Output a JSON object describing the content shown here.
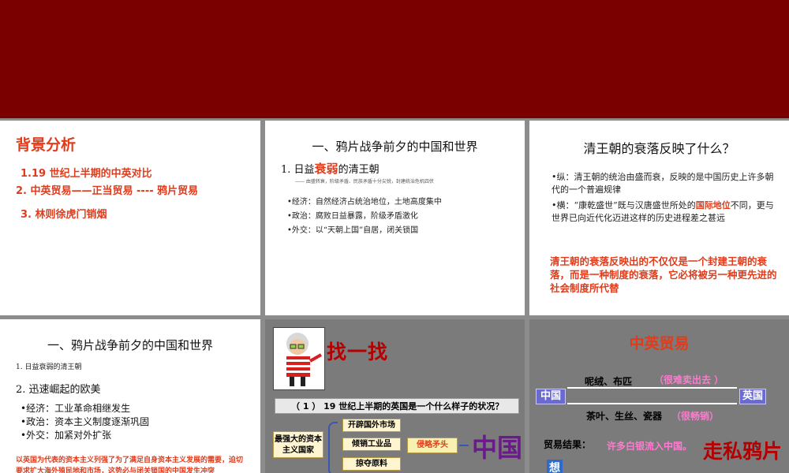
{
  "slide1": {
    "title": "背景分析",
    "items": [
      "1.19 世纪上半期的中英对比",
      "2. 中英贸易——正当贸易 ---- 鸦片贸易",
      "3. 林则徐虎门销烟"
    ]
  },
  "slide2": {
    "heading": "一、鸦片战争前夕的中国和世界",
    "sub_prefix": "1. 日益",
    "sub_emph": "衰弱",
    "sub_suffix": "的清王朝",
    "quote": "—— 由盛转衰，阶级矛盾、民族矛盾十分尖锐，封建统治危机四伏",
    "bullets": [
      "•经济：自然经济占统治地位，土地高度集中",
      "•政治：腐败日益暴露，阶级矛盾激化",
      "•外交：以“天朝上国”自居，闭关锁国"
    ]
  },
  "slide3": {
    "heading": "清王朝的衰落反映了什么？",
    "para1": "•纵：清王朝的统治由盛而衰，反映的是中国历史上许多朝代的一个普遍规律",
    "para2_a": "•横：“康乾盛世”既与汉唐盛世所处的",
    "para2_hl": "国际地位",
    "para2_b": "不同，更与世界已向近代化迈进这样的历史进程差之甚远",
    "conclusion": "清王朝的衰落反映出的不仅仅是一个封建王朝的衰落，而是一种制度的衰落，它必将被另一种更先进的社会制度所代替"
  },
  "slide4": {
    "heading": "一、鸦片战争前夕的中国和世界",
    "small": "1. 日益衰弱的清王朝",
    "sub": "2. 迅速崛起的欧美",
    "bullets": [
      "•经济：工业革命相继发生",
      "•政治：资本主义制度逐渐巩固",
      "•外交：加紧对外扩张"
    ],
    "note": "以英国为代表的资本主义列强了为了满足自身资本主义发展的需要，迫切要求扩大海外殖民地和市场，这势必与闭关锁国的中国发生冲突"
  },
  "slide5": {
    "find_title": "找一找",
    "question": "（ 1 ） 19 世纪上半期的英国是一个什么样子的状况？",
    "capitalist": "最强大的资本主义国家",
    "options": [
      "开辟国外市场",
      "倾销工业品",
      "掠夺原料"
    ],
    "invasion": "侵略矛头",
    "china": "中国"
  },
  "slide6": {
    "heading": "中英贸易",
    "china_label": "中国",
    "britain_label": "英国",
    "import_goods": "呢绒、布匹",
    "import_note": "（很难卖出去 ）",
    "export_goods": "茶叶、生丝、瓷器",
    "export_note": "（很畅销）",
    "result_label": "贸易结果：",
    "result_text": "许多白银流入中国。",
    "smuggle": "走私鸦片",
    "think": "想"
  },
  "colors": {
    "banner": "#7a0000",
    "accent_red": "#e03c1c",
    "gray_slide": "#7b7b7b",
    "country_box": "#6a6ad0",
    "pink": "#ff7ad0"
  }
}
